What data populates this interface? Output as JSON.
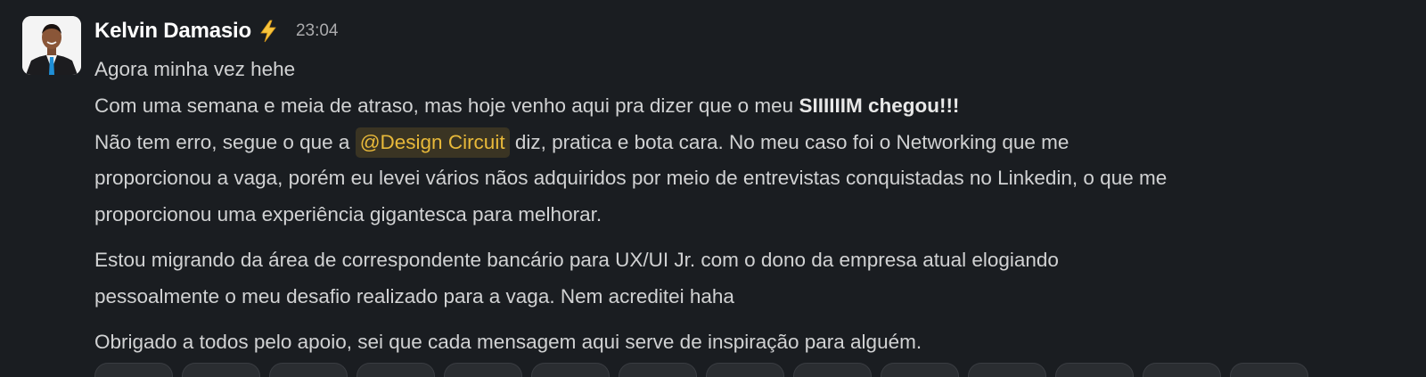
{
  "message": {
    "author": "Kelvin Damasio",
    "status_emoji": "lightning-icon",
    "time": "23:04",
    "line1": "Agora minha vez hehe",
    "line2_text": "Com uma semana e meia de atraso, mas hoje venho aqui pra dizer que o meu ",
    "line2_bold": "SIIIIIIM chegou!!!",
    "line3_before": "Não tem erro, segue o que a ",
    "mention": "@Design Circuit",
    "line3_after": " diz, pratica e bota cara. No meu caso foi o Networking que me",
    "line4": "proporcionou a vaga, porém eu levei vários nãos adquiridos por meio de entrevistas conquistadas no Linkedin, o que me",
    "line5": "proporcionou uma experiência gigantesca para melhorar.",
    "para2_line1": "Estou migrando da área de correspondente bancário para UX/UI Jr. com o dono da empresa atual elogiando",
    "para2_line2": "pessoalmente o meu desafio realizado para a vaga. Nem acreditei haha",
    "para3_line1": "Obrigado a todos pelo apoio, sei que cada mensagem aqui serve de inspiração para alguém."
  },
  "colors": {
    "background": "#1a1d21",
    "mention_text": "#e8b93a",
    "mention_bg": "#3a3423"
  }
}
